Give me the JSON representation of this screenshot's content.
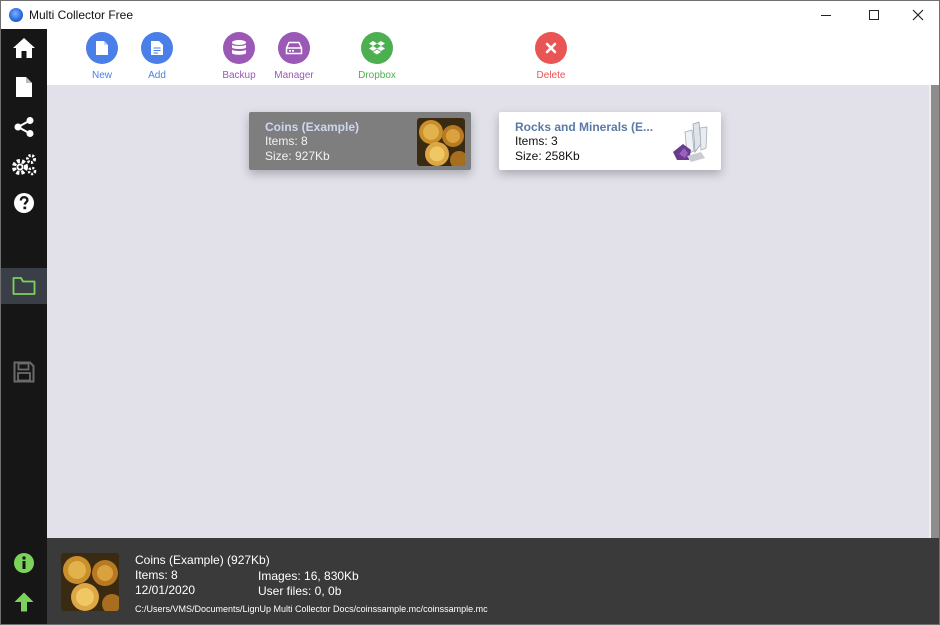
{
  "window": {
    "title": "Multi Collector Free"
  },
  "sidebar": {
    "items": [
      {
        "name": "home-icon"
      },
      {
        "name": "document-icon"
      },
      {
        "name": "share-icon"
      },
      {
        "name": "settings-icon"
      },
      {
        "name": "help-icon"
      },
      {
        "name": "folder-icon",
        "active": true
      },
      {
        "name": "save-icon"
      },
      {
        "name": "info-icon"
      },
      {
        "name": "arrow-up-icon"
      }
    ]
  },
  "toolbar": {
    "new_label": "New",
    "add_label": "Add",
    "backup_label": "Backup",
    "manager_label": "Manager",
    "dropbox_label": "Dropbox",
    "delete_label": "Delete",
    "colors": {
      "new": "#4a7ee8",
      "add": "#4a7ee8",
      "backup": "#9b59b6",
      "manager": "#9b59b6",
      "dropbox": "#4caf50",
      "delete": "#e95454"
    }
  },
  "collections": [
    {
      "title": "Coins (Example)",
      "items": "Items: 8",
      "size": "Size: 927Kb",
      "selected": true
    },
    {
      "title": "Rocks and Minerals (E...",
      "items": "Items: 3",
      "size": "Size: 258Kb",
      "selected": false
    }
  ],
  "info": {
    "title": "Coins (Example) (927Kb)",
    "items": "Items: 8",
    "date": "12/01/2020",
    "images": "Images: 16,  830Kb",
    "user_files": "User files: 0,  0b",
    "path": "C:/Users/VMS/Documents/LignUp Multi Collector Docs/coinssample.mc/coinssample.mc"
  }
}
